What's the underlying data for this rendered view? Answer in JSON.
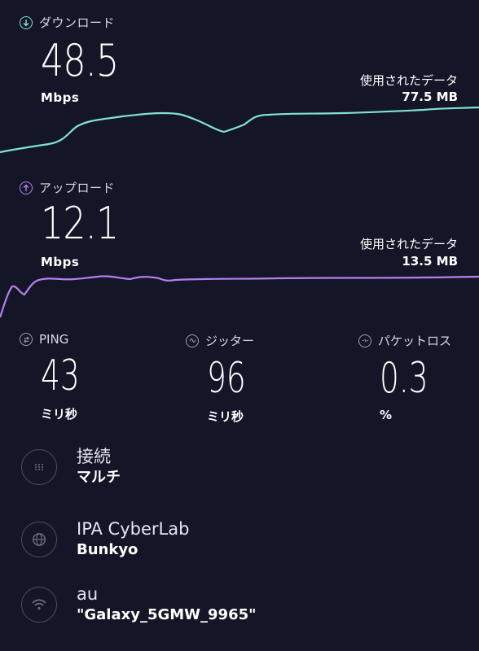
{
  "download": {
    "title": "ダウンロード",
    "value": "48.5",
    "unit": "Mbps",
    "used_label": "使用されたデータ",
    "used_value": "77.5 MB",
    "color": "#7fe3d2"
  },
  "upload": {
    "title": "アップロード",
    "value": "12.1",
    "unit": "Mbps",
    "used_label": "使用されたデータ",
    "used_value": "13.5 MB",
    "color": "#b77ef0"
  },
  "metrics": [
    {
      "title": "PING",
      "value": "43",
      "unit": "ミリ秒",
      "icon": "ping-icon"
    },
    {
      "title": "ジッター",
      "value": "96",
      "unit": "ミリ秒",
      "icon": "jitter-icon"
    },
    {
      "title": "パケットロス",
      "value": "0.3",
      "unit": "%",
      "icon": "packet-loss-icon"
    }
  ],
  "info": {
    "connection": {
      "label": "接続",
      "value": "マルチ",
      "icon": "connections-icon"
    },
    "server": {
      "label": "IPA CyberLab",
      "value": "Bunkyo",
      "icon": "globe-icon"
    },
    "network": {
      "label": "au",
      "value": "\"Galaxy_5GMW_9965\"",
      "icon": "wifi-icon"
    }
  }
}
